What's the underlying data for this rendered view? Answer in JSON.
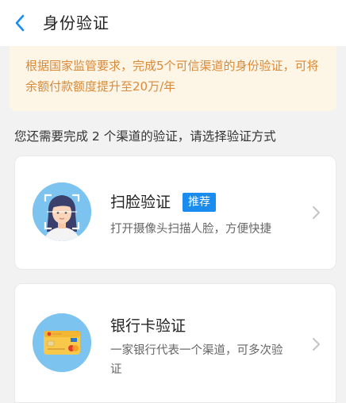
{
  "header": {
    "title": "身份验证"
  },
  "notice": {
    "text": "根据国家监管要求，完成5个可信渠道的身份验证，可将余额付款额度提升至20万/年"
  },
  "instruction": "您还需要完成 2 个渠道的验证，请选择验证方式",
  "methods": [
    {
      "title": "扫脸验证",
      "badge": "推荐",
      "description": "打开摄像头扫描人脸，方便快捷",
      "icon": "face-scan-icon"
    },
    {
      "title": "银行卡验证",
      "description": "一家银行代表一个渠道，可多次验证",
      "icon": "bank-card-icon"
    }
  ],
  "colors": {
    "accent": "#1a8cf0",
    "notice_text": "#d98a3a",
    "notice_bg": "#fdf5e5",
    "icon_bg": "#7cc4ef"
  }
}
